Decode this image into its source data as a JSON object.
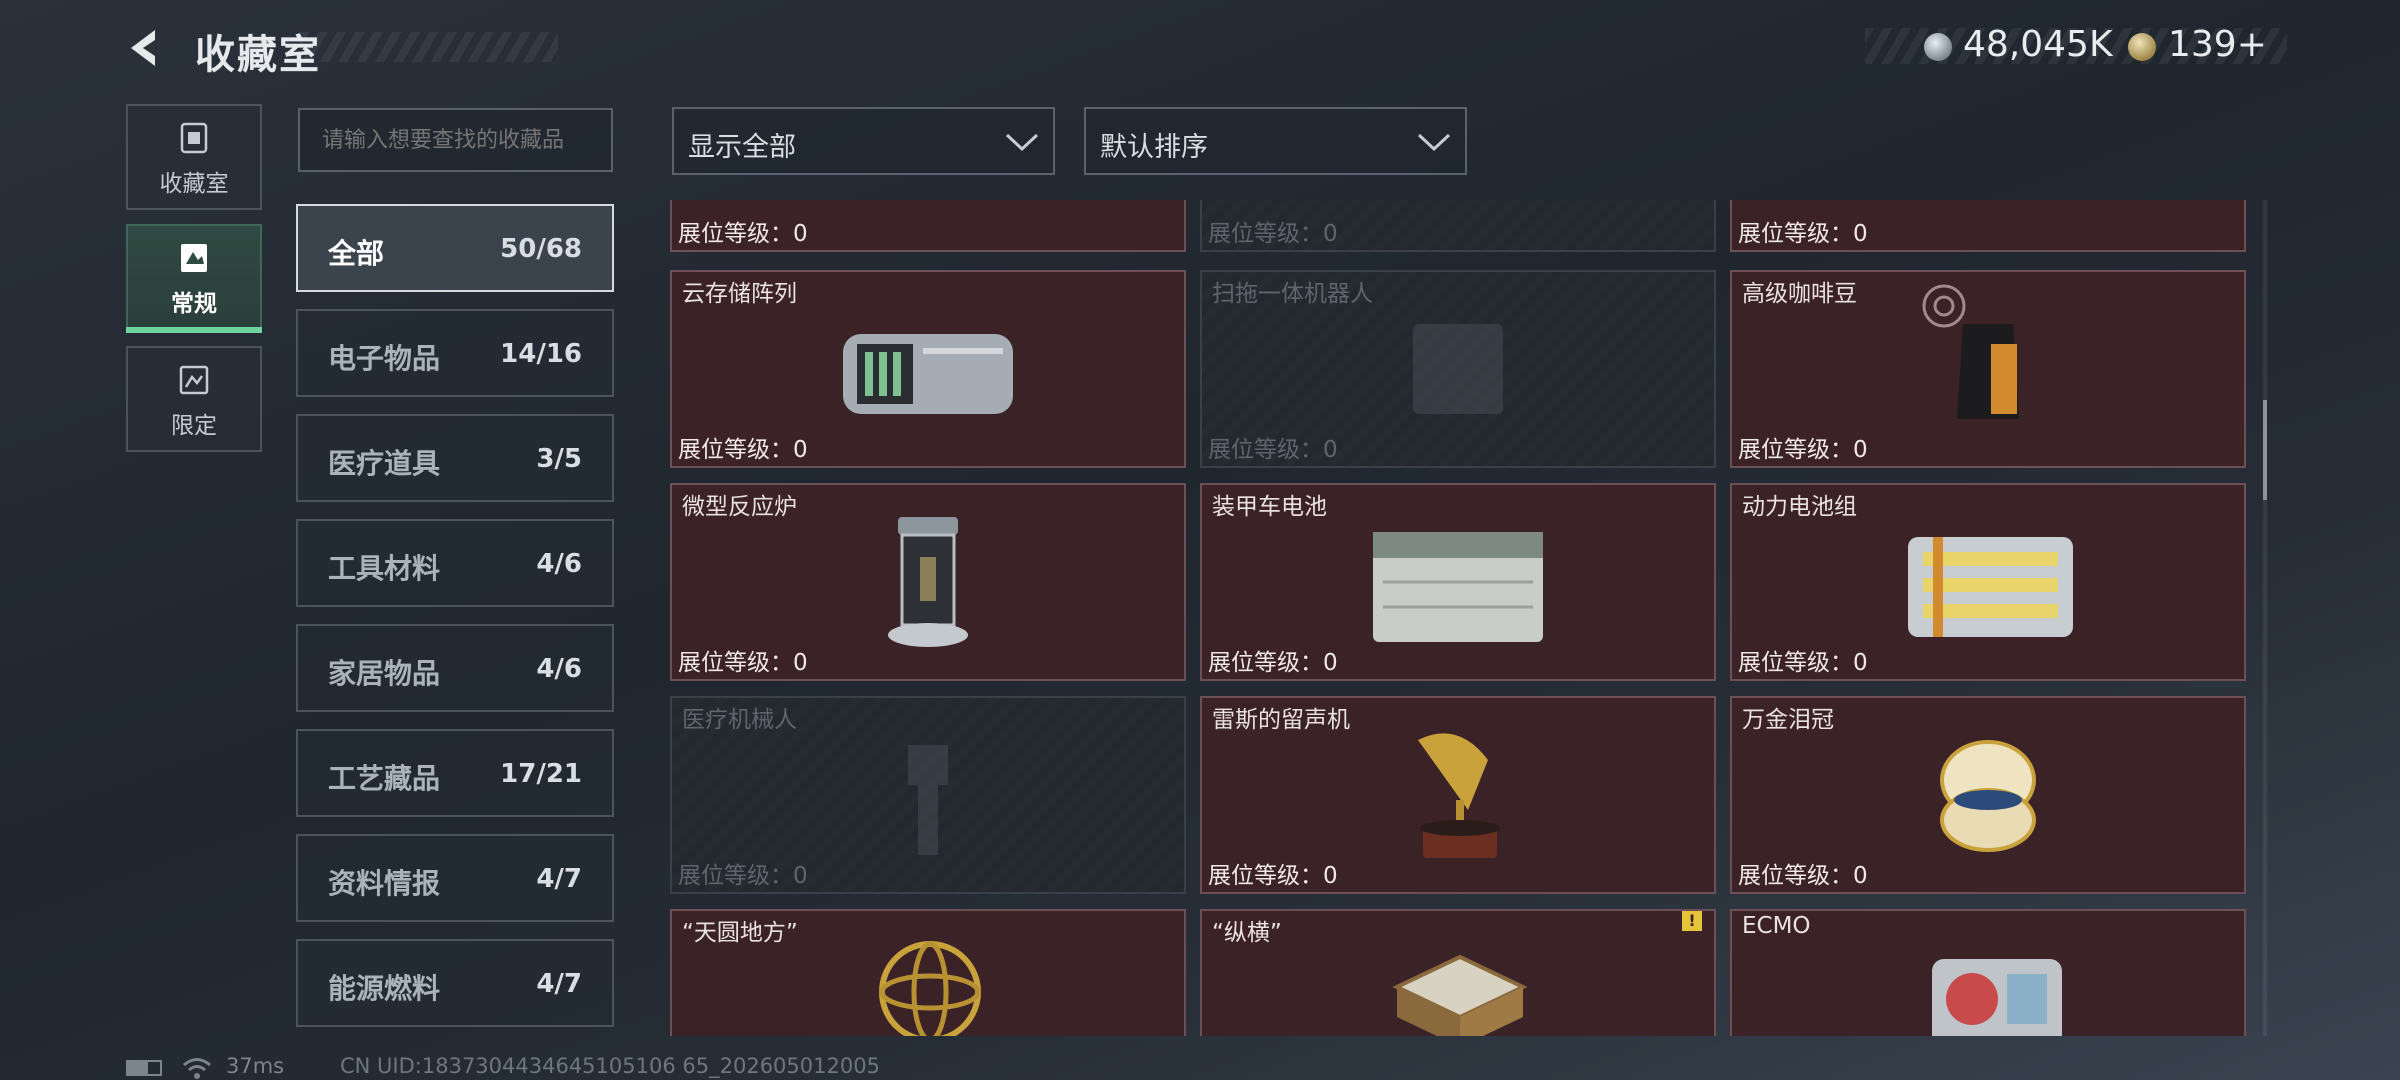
{
  "header": {
    "title": "收藏室",
    "currency_1": "48,045K",
    "currency_2": "139",
    "currency_2_plus": "+"
  },
  "nav": {
    "tabs": [
      {
        "label": "收藏室",
        "icon": "collection-room-icon",
        "active": false
      },
      {
        "label": "常规",
        "icon": "regular-items-icon",
        "active": true
      },
      {
        "label": "限定",
        "icon": "limited-items-icon",
        "active": false
      }
    ],
    "accent_color": "#6fd39d"
  },
  "search": {
    "placeholder": "请输入想要查找的收藏品"
  },
  "filters": {
    "display": "显示全部",
    "sort": "默认排序"
  },
  "categories": [
    {
      "name": "全部",
      "count": "50/68",
      "active": true
    },
    {
      "name": "电子物品",
      "count": "14/16"
    },
    {
      "name": "医疗道具",
      "count": "3/5"
    },
    {
      "name": "工具材料",
      "count": "4/6"
    },
    {
      "name": "家居物品",
      "count": "4/6"
    },
    {
      "name": "工艺藏品",
      "count": "17/21"
    },
    {
      "name": "资料情报",
      "count": "4/7"
    },
    {
      "name": "能源燃料",
      "count": "4/7"
    }
  ],
  "level_label": "展位等级：",
  "cards": [
    {
      "name": "",
      "level": "0",
      "locked": false,
      "icon": "item-icon"
    },
    {
      "name": "",
      "level": "0",
      "locked": true,
      "icon": "item-icon"
    },
    {
      "name": "",
      "level": "0",
      "locked": false,
      "icon": "item-icon"
    },
    {
      "name": "云存储阵列",
      "level": "0",
      "locked": false,
      "icon": "storage-array-icon"
    },
    {
      "name": "扫拖一体机器人",
      "level": "0",
      "locked": true,
      "icon": "robot-vacuum-icon"
    },
    {
      "name": "高级咖啡豆",
      "level": "0",
      "locked": false,
      "icon": "coffee-bag-icon"
    },
    {
      "name": "微型反应炉",
      "level": "0",
      "locked": false,
      "icon": "reactor-icon"
    },
    {
      "name": "装甲车电池",
      "level": "0",
      "locked": false,
      "icon": "vehicle-battery-icon"
    },
    {
      "name": "动力电池组",
      "level": "0",
      "locked": false,
      "icon": "battery-pack-icon"
    },
    {
      "name": "医疗机械人",
      "level": "0",
      "locked": true,
      "icon": "medical-robot-icon"
    },
    {
      "name": "雷斯的留声机",
      "level": "0",
      "locked": false,
      "icon": "gramophone-icon"
    },
    {
      "name": "万金泪冠",
      "level": "0",
      "locked": false,
      "icon": "jeweled-egg-icon"
    },
    {
      "name": "“天圆地方”",
      "level": "",
      "locked": false,
      "icon": "armillary-sphere-icon"
    },
    {
      "name": "“纵横”",
      "level": "",
      "locked": false,
      "icon": "chess-set-icon",
      "warning": "!"
    },
    {
      "name": "ECMO",
      "level": "",
      "locked": false,
      "icon": "ecmo-machine-icon"
    }
  ],
  "status": {
    "ping": "37ms",
    "uid": "CN UID:1837304434645105106 65_202605012005"
  }
}
